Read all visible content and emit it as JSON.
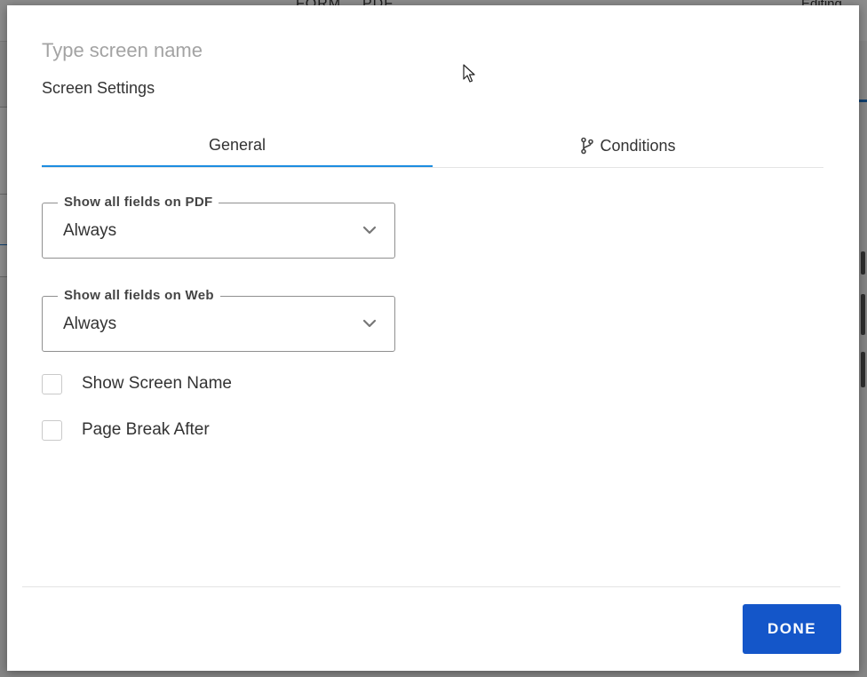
{
  "background": {
    "tab_left": "FORM",
    "tab_right": "PDF",
    "editing_label": "Editing"
  },
  "dialog": {
    "screen_name": {
      "value": "",
      "placeholder": "Type screen name"
    },
    "settings_label": "Screen Settings",
    "tabs": [
      {
        "label": "General",
        "active": true,
        "icon": ""
      },
      {
        "label": "Conditions",
        "active": false,
        "icon": "branch-icon"
      }
    ],
    "pdf_select": {
      "legend": "Show all fields on PDF",
      "value": "Always"
    },
    "web_select": {
      "legend": "Show all fields on Web",
      "value": "Always"
    },
    "checkboxes": [
      {
        "label": "Show Screen Name",
        "checked": false
      },
      {
        "label": "Page Break After",
        "checked": false
      }
    ],
    "done_label": "DONE"
  },
  "colors": {
    "accent": "#1d8de0",
    "primary_button": "#1456c9",
    "text": "#333333",
    "placeholder": "#a3a3a3"
  }
}
